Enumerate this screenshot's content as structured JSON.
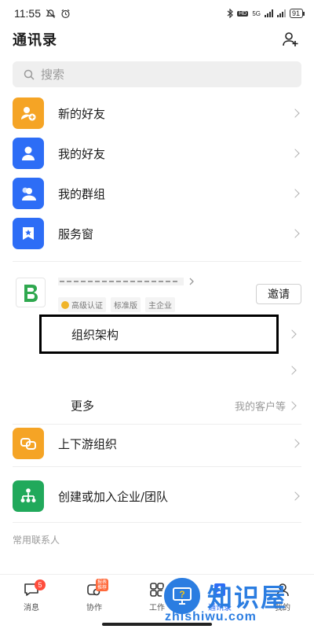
{
  "status_bar": {
    "time": "11:55",
    "network": "5G",
    "battery": "91"
  },
  "header": {
    "title": "通讯录"
  },
  "search": {
    "placeholder": "搜索"
  },
  "menu": [
    {
      "label": "新的好友",
      "icon": "new-friend-icon",
      "color": "#f5a425"
    },
    {
      "label": "我的好友",
      "icon": "friend-icon",
      "color": "#2d6df6"
    },
    {
      "label": "我的群组",
      "icon": "group-icon",
      "color": "#2d6df6"
    },
    {
      "label": "服务窗",
      "icon": "service-window-icon",
      "color": "#2d6df6"
    }
  ],
  "org": {
    "tags": [
      "高级认证",
      "标准版",
      "主企业"
    ],
    "invite_label": "邀请",
    "structure_label": "组织架构",
    "more_label": "更多",
    "more_hint": "我的客户等"
  },
  "actions": [
    {
      "label": "上下游组织",
      "icon": "upstream-downstream-icon",
      "color": "#f5a425"
    },
    {
      "label": "创建或加入企业/团队",
      "icon": "create-team-icon",
      "color": "#21a95b"
    }
  ],
  "section": {
    "frequent_contacts": "常用联系人"
  },
  "tabbar": {
    "tabs": [
      {
        "label": "消息",
        "badge": "5"
      },
      {
        "label": "协作",
        "badge": "报表 推荐"
      },
      {
        "label": "工作"
      },
      {
        "label": "通讯录"
      },
      {
        "label": "我的"
      }
    ]
  },
  "watermark": {
    "text": "知识屋",
    "url": "zhishiwu.com"
  }
}
